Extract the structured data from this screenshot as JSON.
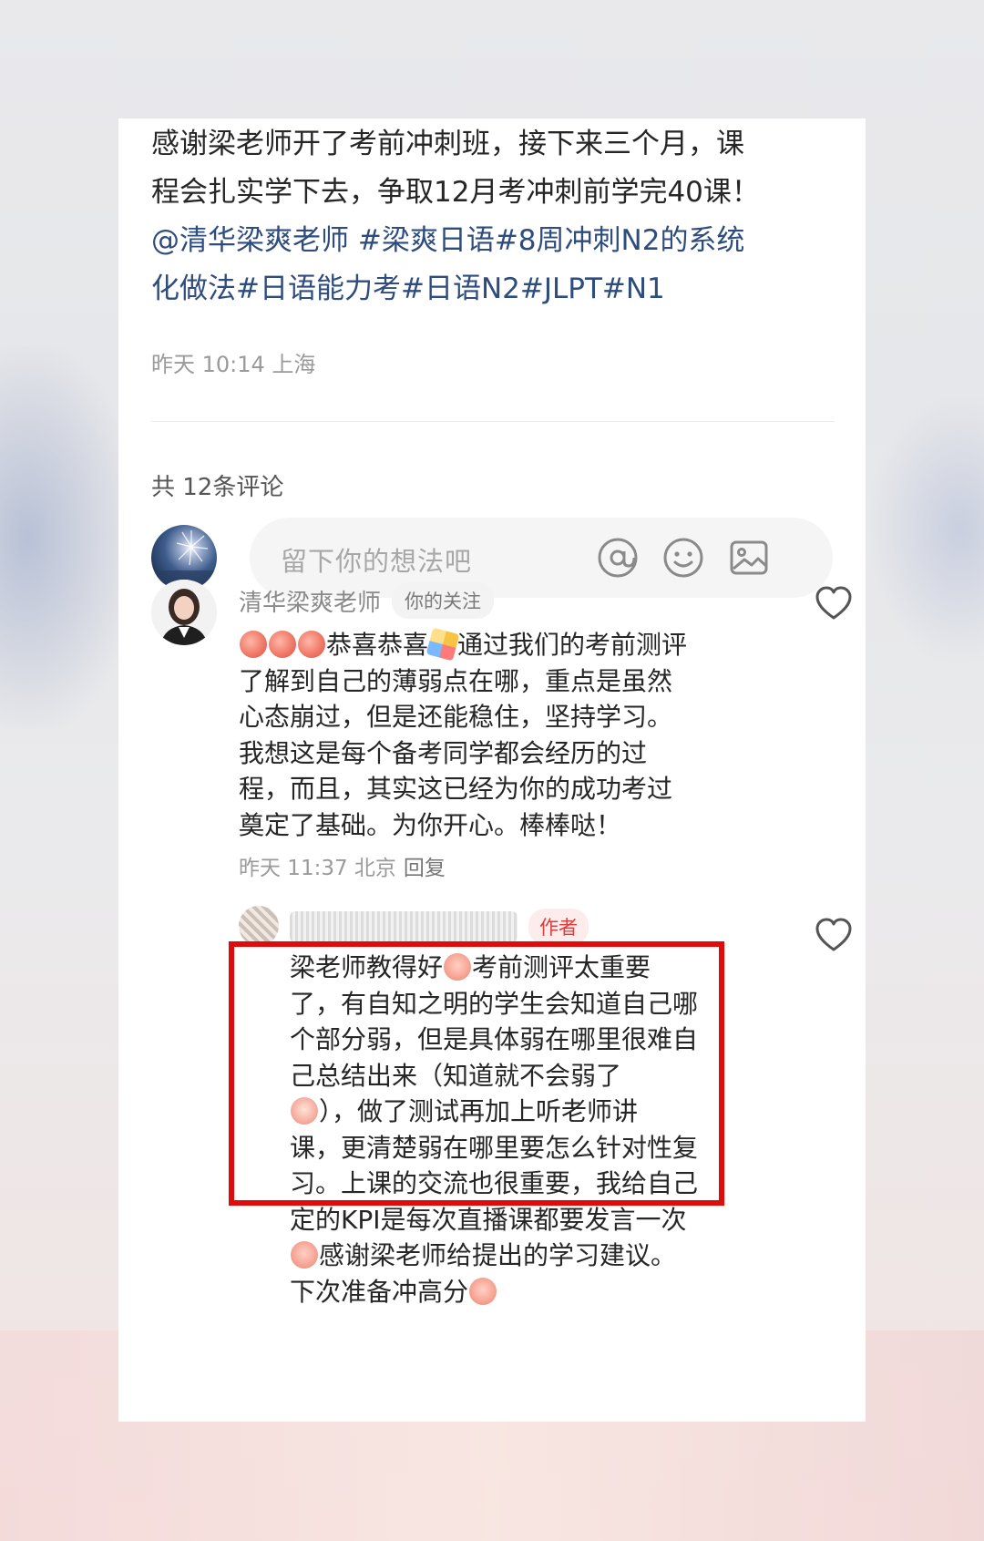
{
  "post": {
    "text_lines": [
      "感谢梁老师开了考前冲刺班，接下来三个月，课",
      "程会扎实学下去，争取12月考冲刺前学完40课！"
    ],
    "tag_lines": [
      "@清华梁爽老师 #梁爽日语#8周冲刺N2的系统",
      "化做法#日语能力考#日语N2#JLPT#N1"
    ],
    "meta": "昨天 10:14 上海"
  },
  "comments_header": {
    "count_label": "共 12条评论"
  },
  "comment_input": {
    "placeholder": "留下你的想法吧",
    "icons": [
      "at-icon",
      "emoji-icon",
      "image-icon"
    ]
  },
  "comments": [
    {
      "name": "清华梁爽老师",
      "badge": "你的关注",
      "lines": [
        "恭喜恭喜",
        "通过我们的考前测评",
        "了解到自己的薄弱点在哪，重点是虽然",
        "心态崩过，但是还能稳住，坚持学习。",
        "我想这是每个备考同学都会经历的过",
        "程，而且，其实这已经为你的成功考过",
        "奠定了基础。为你开心。棒棒哒！"
      ],
      "meta": "昨天 11:37 北京",
      "reply_label": "回复"
    },
    {
      "badge": "作者",
      "lines": [
        "梁老师教得好",
        "考前测评太重要",
        "了，有自知之明的学生会知道自己哪",
        "个部分弱，但是具体弱在哪里很难自",
        "己总结出来（知道就不会弱了",
        "），做了测试再加上听老师讲",
        "课，更清楚弱在哪里要怎么针对性复",
        "习。上课的交流也很重要，我给自己",
        "定的KPI是每次直播课都要发言一次",
        "感谢梁老师给提出的学习建议。",
        "下次准备冲高分"
      ]
    }
  ],
  "colors": {
    "highlight_box": "#e00b0b",
    "hashtag": "#2e4c7d",
    "author_badge": "#e03b3b"
  }
}
